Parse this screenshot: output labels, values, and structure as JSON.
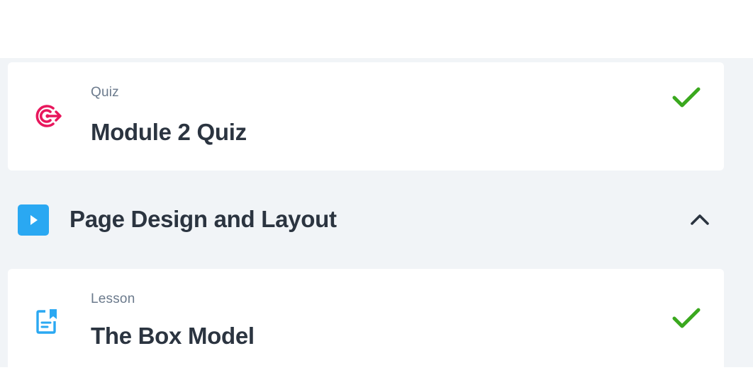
{
  "items": {
    "quiz": {
      "type_label": "Quiz",
      "title": "Module 2 Quiz",
      "icon": "target-icon",
      "status_icon": "checkmark-icon"
    },
    "lesson": {
      "type_label": "Lesson",
      "title": "The Box Model",
      "icon": "document-icon",
      "status_icon": "checkmark-icon"
    }
  },
  "section": {
    "title": "Page Design and Layout",
    "icon": "play-icon",
    "toggle_icon": "chevron-up-icon",
    "expanded": true
  },
  "colors": {
    "page_background": "#f1f4f7",
    "card_background": "#ffffff",
    "quiz_icon": "#e8175d",
    "lesson_icon": "#2aa8f2",
    "check": "#3aa81e",
    "section_icon": "#2aa8f2",
    "text_primary": "#2b3440",
    "text_secondary": "#6b7a8c"
  }
}
